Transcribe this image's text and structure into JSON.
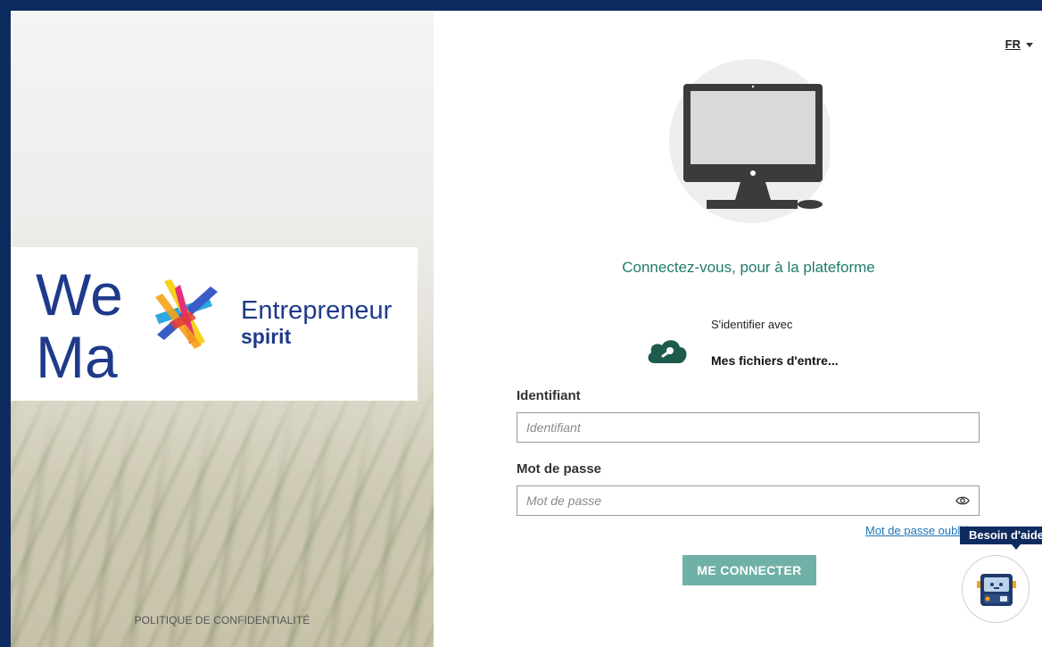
{
  "language": {
    "code": "FR"
  },
  "brand": {
    "logo_we": "We",
    "logo_ma": "Ma",
    "logo_line1": "Entrepreneur",
    "logo_line2": "spirit"
  },
  "left_footer": {
    "privacy_link": "POLITIQUE DE CONFIDENTIALITÉ"
  },
  "login": {
    "welcome": "Connectez-vous, pour à la plateforme",
    "sso_with": "S'identifier avec",
    "sso_provider": "Mes fichiers d'entre...",
    "username_label": "Identifiant",
    "username_placeholder": "Identifiant",
    "password_label": "Mot de passe",
    "password_placeholder": "Mot de passe",
    "forgot_link": "Mot de passe oublié",
    "submit": "ME CONNECTER"
  },
  "help": {
    "tooltip": "Besoin d'aide"
  },
  "colors": {
    "frame": "#0e2b5f",
    "accent_teal": "#1f7a6c",
    "button": "#6fb1a6",
    "link": "#1a73b8",
    "logo_navy": "#1f3a8a"
  }
}
